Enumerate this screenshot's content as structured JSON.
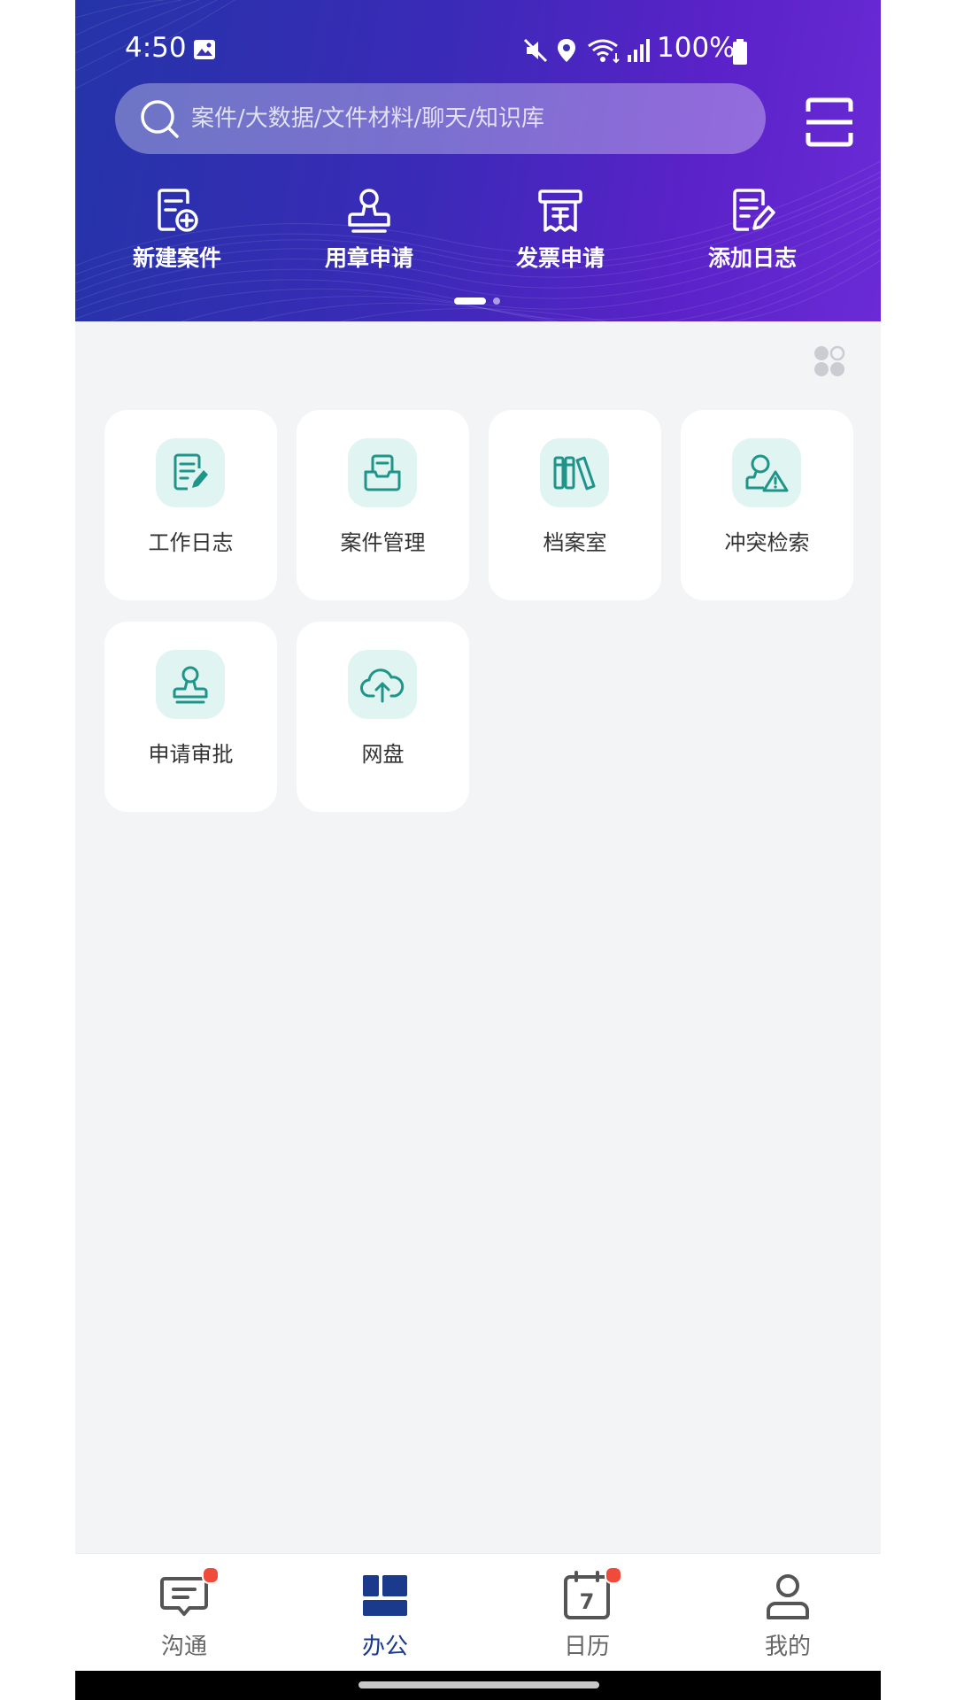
{
  "status_bar": {
    "time": "4:50",
    "battery": "100%",
    "icons": [
      "image-icon",
      "mute-icon",
      "location-icon",
      "wifi-icon",
      "signal-icon",
      "battery-icon"
    ]
  },
  "search": {
    "placeholder": "案件/大数据/文件材料/聊天/知识库",
    "icon": "search-icon"
  },
  "scan_icon": "scan-icon",
  "quick_actions": [
    {
      "label": "新建案件",
      "icon": "new-case-icon"
    },
    {
      "label": "用章申请",
      "icon": "seal-icon"
    },
    {
      "label": "发票申请",
      "icon": "invoice-icon"
    },
    {
      "label": "添加日志",
      "icon": "add-log-icon"
    }
  ],
  "carousel": {
    "pages": 2,
    "active": 1
  },
  "tiles": [
    {
      "label": "工作日志",
      "icon": "work-log-icon"
    },
    {
      "label": "案件管理",
      "icon": "case-management-icon"
    },
    {
      "label": "档案室",
      "icon": "archive-icon"
    },
    {
      "label": "冲突检索",
      "icon": "conflict-search-icon"
    },
    {
      "label": "申请审批",
      "icon": "approval-icon"
    },
    {
      "label": "网盘",
      "icon": "cloud-drive-icon"
    }
  ],
  "tabs": [
    {
      "label": "沟通",
      "icon": "chat-icon",
      "badge": true,
      "active": false
    },
    {
      "label": "办公",
      "icon": "office-icon",
      "badge": false,
      "active": true
    },
    {
      "label": "日历",
      "icon": "calendar-icon",
      "badge": true,
      "active": false,
      "day": "7"
    },
    {
      "label": "我的",
      "icon": "profile-icon",
      "badge": false,
      "active": false
    }
  ],
  "colors": {
    "header_start": "#2434a8",
    "header_end": "#6a2bd6",
    "tile_icon_bg": "#e0f4f2",
    "tile_icon": "#1f9488",
    "active_tab": "#1a3a8c",
    "badge": "#f04a3a"
  }
}
